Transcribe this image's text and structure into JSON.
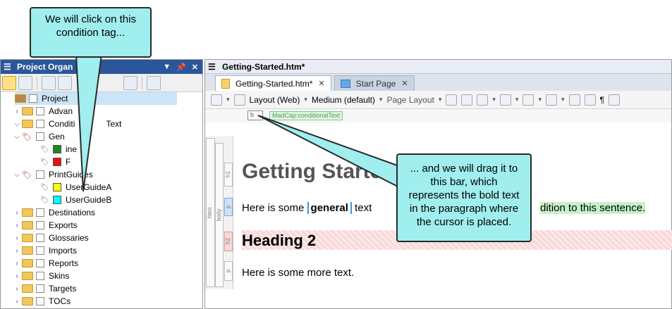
{
  "left_panel": {
    "title": "Project Organ",
    "tree": [
      {
        "label": "Project",
        "level": 0
      },
      {
        "label": "Advan",
        "level": 1
      },
      {
        "label": "Conditi",
        "suffix": "Text",
        "level": 1
      },
      {
        "label": "Gen",
        "level": 2
      },
      {
        "label": "ine",
        "level": 3,
        "color": "#1a8a1a"
      },
      {
        "label": "F",
        "level": 3,
        "color": "#e81010"
      },
      {
        "label": "Print",
        "suffix": "Guides",
        "level": 2
      },
      {
        "label": "UserGuideA",
        "level": 3,
        "color": "#ffff00"
      },
      {
        "label": "UserGuideB",
        "level": 3,
        "color": "#00ffff"
      },
      {
        "label": "Destinations",
        "level": 1
      },
      {
        "label": "Exports",
        "level": 1
      },
      {
        "label": "Glossaries",
        "level": 1
      },
      {
        "label": "Imports",
        "level": 1
      },
      {
        "label": "Reports",
        "level": 1
      },
      {
        "label": "Skins",
        "level": 1
      },
      {
        "label": "Targets",
        "level": 1
      },
      {
        "label": "TOCs",
        "level": 1
      }
    ]
  },
  "editor": {
    "title": "Getting-Started.htm*",
    "tabs": [
      {
        "label": "Getting-Started.htm*",
        "active": true
      },
      {
        "label": "Start Page",
        "active": false
      }
    ],
    "toolbar": {
      "layout": "Layout (Web)",
      "medium": "Medium (default)",
      "page_layout": "Page Layout"
    },
    "condition_tag_text": "MadCap:conditionalText",
    "condition_small_label": "b",
    "structure_labels": {
      "html": "html",
      "body": "body",
      "h1": "h1",
      "p": "p",
      "h2": "h2",
      "p2": "p"
    },
    "content": {
      "heading1": "Getting Starte",
      "para1_start": "Here is some ",
      "para1_bold": "general",
      "para1_mid": " text",
      "para1_end": "dition to this sentence.",
      "heading2": "Heading 2",
      "para2": "Here is some more text."
    }
  },
  "callouts": {
    "top": "We will click on this condition tag...",
    "right": "... and we will drag it to this bar, which represents the bold text in the paragraph where the cursor is placed."
  },
  "colors": {
    "callout_fill": "#a0eeee",
    "title_bar": "#2b579a"
  }
}
